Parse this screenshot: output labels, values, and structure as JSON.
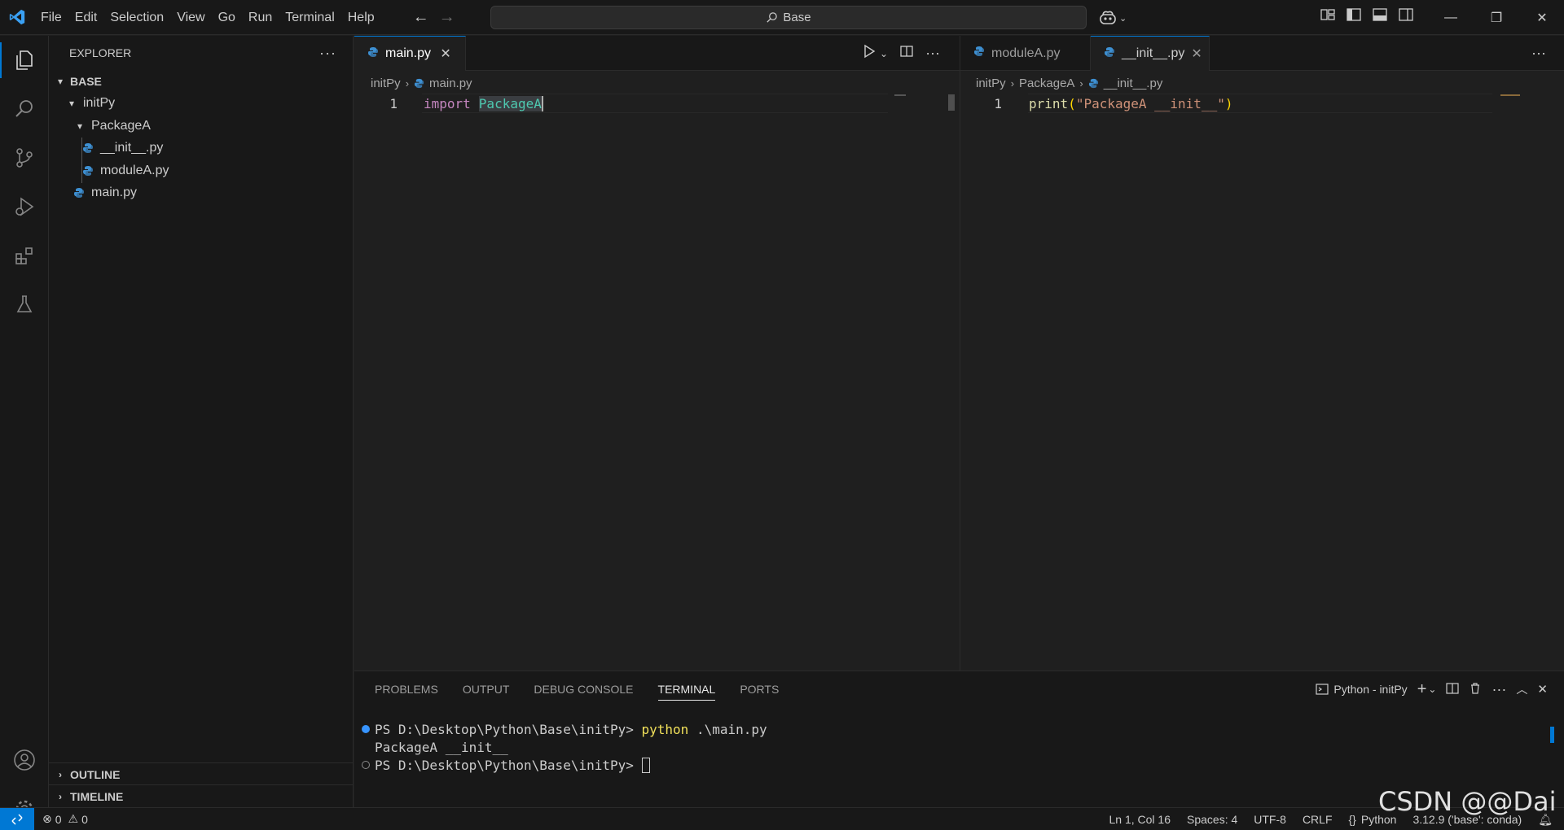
{
  "titlebar": {
    "menu": [
      "File",
      "Edit",
      "Selection",
      "View",
      "Go",
      "Run",
      "Terminal",
      "Help"
    ],
    "search_text": "Base",
    "accent": "#0078d4"
  },
  "explorer": {
    "title": "EXPLORER",
    "root": "BASE",
    "folder_initpy": "initPy",
    "folder_packagea": "PackageA",
    "file_init": "__init__.py",
    "file_modulea": "moduleA.py",
    "file_main": "main.py",
    "outline": "OUTLINE",
    "timeline": "TIMELINE"
  },
  "editor_left": {
    "tab": "main.py",
    "breadcrumb_folder": "initPy",
    "breadcrumb_file": "main.py",
    "line_number": "1",
    "code_keyword": "import",
    "code_ident": "PackageA"
  },
  "editor_right": {
    "tab_modulea": "moduleA.py",
    "tab_init": "__init__.py",
    "breadcrumb_folder": "initPy",
    "breadcrumb_package": "PackageA",
    "breadcrumb_file": "__init__.py",
    "line_number": "1",
    "code_fn": "print",
    "code_open": "(",
    "code_str": "\"PackageA __init__\"",
    "code_close": ")"
  },
  "panel": {
    "tabs": [
      "PROBLEMS",
      "OUTPUT",
      "DEBUG CONSOLE",
      "TERMINAL",
      "PORTS"
    ],
    "terminal_name": "Python - initPy",
    "line1_prompt": "PS D:\\Desktop\\Python\\Base\\initPy> ",
    "line1_cmd": "python",
    "line1_arg": " .\\main.py",
    "line2": "PackageA __init__",
    "line3_prompt": "PS D:\\Desktop\\Python\\Base\\initPy> "
  },
  "statusbar": {
    "errors": "0",
    "warnings": "0",
    "position": "Ln 1, Col 16",
    "spaces": "Spaces: 4",
    "encoding": "UTF-8",
    "eol": "CRLF",
    "language": "Python",
    "interpreter": "3.12.9 ('base': conda)"
  },
  "watermark": "CSDN @@Dai"
}
